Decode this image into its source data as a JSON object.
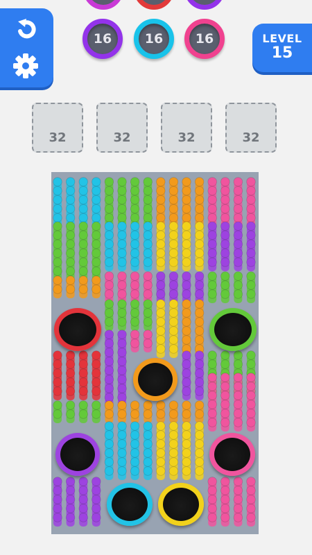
{
  "hud": {
    "undo_icon": "undo-arrow-icon",
    "settings_icon": "gear-icon",
    "level_label": "LEVEL",
    "level_number": "15",
    "accent_color": "#2f7df0"
  },
  "queue_top_row": [
    {
      "color": "#c93ad6"
    },
    {
      "color": "#e23a3a"
    },
    {
      "color": "#9333ea"
    }
  ],
  "target_caps": [
    {
      "count": "16",
      "color": "#9333ea"
    },
    {
      "count": "16",
      "color": "#19c3ea"
    },
    {
      "count": "16",
      "color": "#f0428f"
    }
  ],
  "slots": [
    {
      "capacity": "32"
    },
    {
      "capacity": "32"
    },
    {
      "capacity": "32"
    },
    {
      "capacity": "32"
    }
  ],
  "board": {
    "palette": {
      "cyan": "#22c3e6",
      "green": "#63c93a",
      "orange": "#f29a1c",
      "yellow": "#f2d21c",
      "pink": "#f0559e",
      "purple": "#9d43e0",
      "red": "#e3343b"
    },
    "holes": [
      {
        "color": "red"
      },
      {
        "color": "green"
      },
      {
        "color": "orange"
      },
      {
        "color": "purple"
      },
      {
        "color": "pink"
      },
      {
        "color": "cyan"
      },
      {
        "color": "yellow"
      }
    ]
  }
}
